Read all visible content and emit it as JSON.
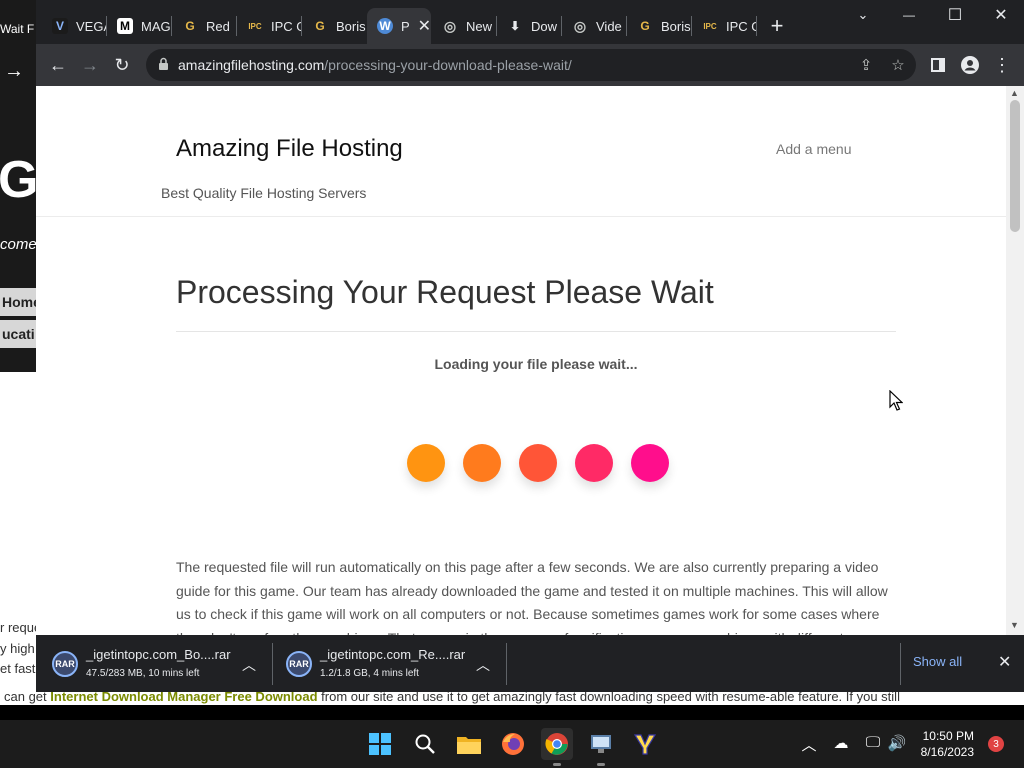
{
  "background_window": {
    "tab_text": "Wait F",
    "big_letter": "G",
    "welcome": "come",
    "menu_home": "Home",
    "menu_education": "ucati",
    "snippets": [
      "r reque",
      "y high",
      "et fast"
    ]
  },
  "browser": {
    "tabs": [
      {
        "icon": "vegamovies-icon",
        "icon_text": "V",
        "label": "VEGA"
      },
      {
        "icon": "m-logo-icon",
        "icon_text": "M",
        "label": "MAG"
      },
      {
        "icon": "google-icon",
        "icon_text": "G",
        "label": "Red"
      },
      {
        "icon": "ipc-games-icon",
        "icon_text": "IPC",
        "label": "IPC G"
      },
      {
        "icon": "google-icon",
        "icon_text": "G",
        "label": "Boris"
      },
      {
        "icon": "wordpress-icon",
        "icon_text": "W",
        "label": "P",
        "active": true
      },
      {
        "icon": "globe-icon",
        "icon_text": "◎",
        "label": "New"
      },
      {
        "icon": "download-icon",
        "icon_text": "⬇",
        "label": "Dow"
      },
      {
        "icon": "globe-icon",
        "icon_text": "◎",
        "label": "Vide"
      },
      {
        "icon": "google-icon",
        "icon_text": "G",
        "label": "Boris"
      },
      {
        "icon": "ipc-games-icon",
        "icon_text": "IPC",
        "label": "IPC G"
      }
    ],
    "new_tab_glyph": "+",
    "window_controls": {
      "tab_search": "⌄",
      "minimize": "—",
      "maximize": "☐",
      "close": "✕"
    },
    "url": {
      "host": "amazingfilehosting.com",
      "path": "/processing-your-download-please-wait/"
    }
  },
  "page": {
    "site_title": "Amazing File Hosting",
    "tagline": "Best Quality File Hosting Servers",
    "menu_placeholder": "Add a menu",
    "heading": "Processing Your Request Please Wait",
    "loading_text": "Loading your file please wait...",
    "dot_colors": [
      "#ff9411",
      "#ff7b1d",
      "#ff5537",
      "#ff2a66",
      "#ff0e8c"
    ],
    "body_text": "The requested file will run automatically on this page after a few seconds. We are also currently preparing a video guide for this game. Our team has already downloaded the game and tested it on multiple machines. This will allow us to check if this game will work on all computers or not. Because sometimes games work for some cases where they don't run for other machines. That we are in the process of verification on many machines with different"
  },
  "downloads": {
    "items": [
      {
        "name": "_igetintopc.com_Bo....rar",
        "status": "47.5/283 MB, 10 mins left"
      },
      {
        "name": "_igetintopc.com_Re....rar",
        "status": "1.2/1.8 GB, 4 mins left"
      }
    ],
    "show_all": "Show all"
  },
  "background_strip": {
    "prefix": "can get",
    "link": "Internet Download Manager Free Download",
    "suffix": "from our site and use it to get amazingly fast downloading speed with resume-able feature. If you still"
  },
  "taskbar": {
    "time": "10:50 PM",
    "date": "8/16/2023",
    "notifications": "3",
    "apps": [
      "start-icon",
      "search-icon",
      "file-explorer-icon",
      "firefox-icon",
      "chrome-icon",
      "app-icon",
      "yandex-icon"
    ]
  }
}
